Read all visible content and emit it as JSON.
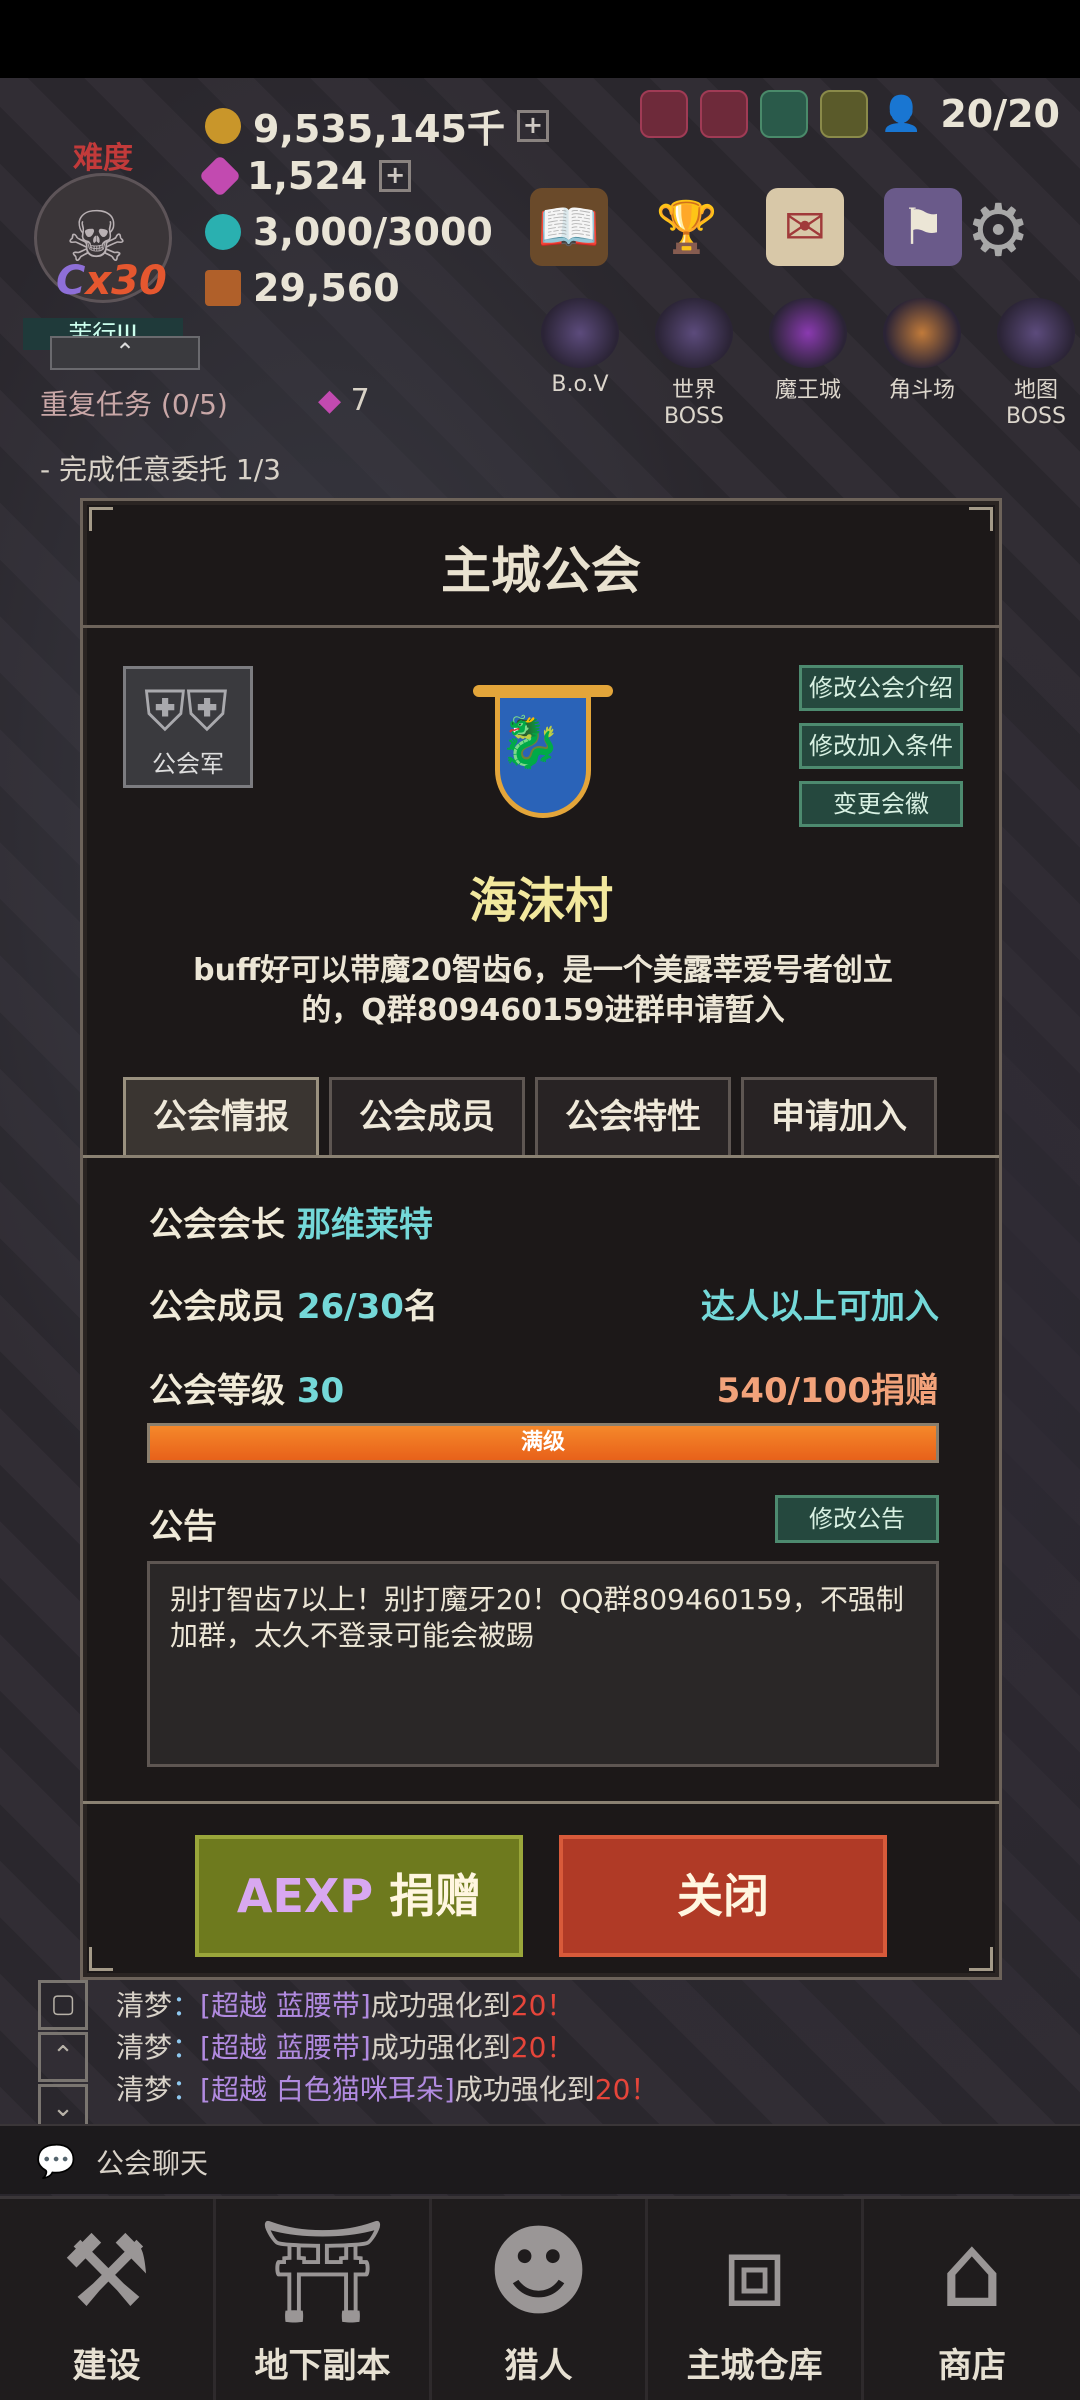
{
  "hud": {
    "difficulty_label": "难度",
    "difficulty_mult_c": "C",
    "difficulty_mult": "x30",
    "difficulty_name": "苦行III",
    "gold": "9,535,145千",
    "gems": "1,524",
    "stamina": "3,000/3000",
    "chest": "29,560",
    "slot_count": "20/20",
    "bosses": [
      "B.o.V",
      "世界BOSS",
      "魔王城",
      "角斗场",
      "地图BOSS"
    ],
    "quest_title": "重复任务 (0/5)",
    "quest_reward": "7",
    "quest_sub": "- 完成任意委托 1/3"
  },
  "dialog": {
    "title": "主城公会",
    "rank_badge_label": "公会军",
    "buttons": {
      "edit_intro": "修改公会介绍",
      "edit_join": "修改加入条件",
      "change_emblem": "变更会徽"
    },
    "guild_name": "海沫村",
    "guild_desc": "buff好可以带魔20智齿6，是一个美露莘爱号者创立的，Q群809460159进群申请暂入",
    "tabs": [
      "公会情报",
      "公会成员",
      "公会特性",
      "申请加入"
    ],
    "info": {
      "leader_label": "公会会长",
      "leader_name": "那维莱特",
      "members_label": "公会成员",
      "members_value": "26/30",
      "members_unit": "名",
      "join_condition": "达人以上可加入",
      "level_label": "公会等级",
      "level_value": "30",
      "donation": "540/100捐赠",
      "level_bar_text": "满级",
      "level_progress": 1.0
    },
    "notice_label": "公告",
    "edit_notice": "修改公告",
    "notice_text": "别打智齿7以上！别打魔牙20！QQ群809460159，不强制加群，太久不登录可能会被踢",
    "donate_prefix": "AEXP",
    "donate_label": "捐赠",
    "close_label": "关闭"
  },
  "chat": {
    "lines": [
      {
        "name": "清梦",
        "item": "[超越 蓝腰带]",
        "text": "成功强化到",
        "level": "20！"
      },
      {
        "name": "清梦",
        "item": "[超越 蓝腰带]",
        "text": "成功强化到",
        "level": "20！"
      },
      {
        "name": "清梦",
        "item": "[超越 白色猫咪耳朵]",
        "text": "成功强化到",
        "level": "20！"
      }
    ],
    "footer_label": "公会聊天"
  },
  "nav": [
    "建设",
    "地下副本",
    "猎人",
    "主城仓库",
    "商店"
  ],
  "colors": {
    "accent_green": "#25483e",
    "donate_bg": "#6e7a1e",
    "close_bg": "#b03a26",
    "guild_name": "#f2e89e",
    "value_cyan": "#74d8d8"
  }
}
